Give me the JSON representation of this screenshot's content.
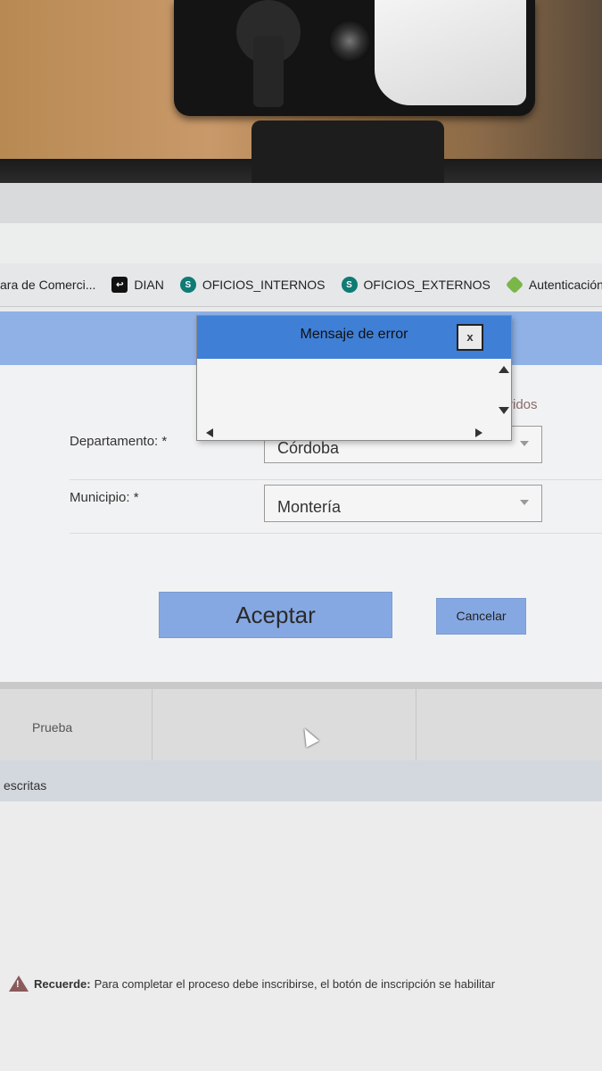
{
  "bookmarks": [
    {
      "label": "ara de Comerci...",
      "icon": "none"
    },
    {
      "label": "DIAN",
      "icon": "dian-icon"
    },
    {
      "label": "OFICIOS_INTERNOS",
      "icon": "sharepoint-icon"
    },
    {
      "label": "OFICIOS_EXTERNOS",
      "icon": "sharepoint-icon"
    },
    {
      "label": "Autenticación:",
      "icon": "auth-icon"
    }
  ],
  "form": {
    "required_note": "ridos",
    "departamento_label": "Departamento: *",
    "departamento_value": "Córdoba",
    "municipio_label": "Municipio: *",
    "municipio_value": "Montería",
    "accept_label": "Aceptar",
    "cancel_label": "Cancelar"
  },
  "modal": {
    "title": "Mensaje de error",
    "close_label": "x",
    "body": ""
  },
  "sections": {
    "prueba": "Prueba",
    "inscritas": "escritas"
  },
  "notice": {
    "bold": "Recuerde:",
    "text": "Para completar el proceso debe inscribirse, el botón de inscripción se habilitar"
  },
  "colors": {
    "modal_title_bar": "#3f7fd6",
    "button": "#86a8e2",
    "header_band": "#8fb1e6"
  }
}
